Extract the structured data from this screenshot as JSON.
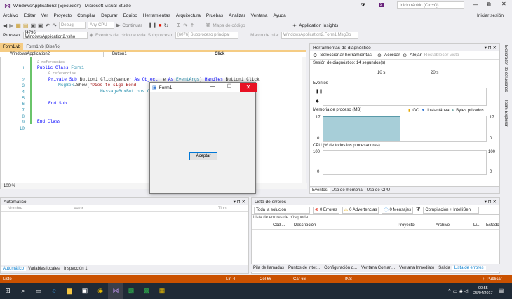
{
  "window": {
    "title": "WindowsApplication2 (Ejecución) - Microsoft Visual Studio",
    "quick_launch": "Inicio rápido (Ctrl+Q)",
    "notif": "2",
    "signin": "Iniciar sesión"
  },
  "menu": [
    "Archivo",
    "Editar",
    "Ver",
    "Proyecto",
    "Compilar",
    "Depurar",
    "Equipo",
    "Herramientas",
    "Arquitectura",
    "Pruebas",
    "Analizar",
    "Ventana",
    "Ayuda"
  ],
  "toolbar": {
    "config": "Debug",
    "platform": "Any CPU",
    "continue": "Continuar",
    "codemap": "Mapa de código",
    "insights": "Application Insights"
  },
  "toolbar2": {
    "process_label": "Proceso:",
    "process": "[4796] WindowsApplication2.vsho",
    "lifecycle": "Eventos del ciclo de vida",
    "thread_label": "Subproceso:",
    "thread": "[6076] Subproceso principal",
    "stack_label": "Marco de pila:",
    "stack": "WindowsApplication2.Form1.MsgBo"
  },
  "editor": {
    "tabs": [
      "Form1.vb",
      "Form1.vb [Diseño]"
    ],
    "nav": [
      "WindowsApplication2",
      "Button1",
      "Click"
    ],
    "zoom": "100 %",
    "line_numbers": [
      "1",
      "2",
      "3",
      "4",
      "5",
      "6",
      "7",
      "8",
      "9",
      "10"
    ],
    "refs1": "2 referencias",
    "refs2": "0 referencias",
    "l1a": "Public ",
    "l1b": "Class ",
    "l1c": "Form1",
    "l2a": "Private Sub ",
    "l2b": "Button1_Click(sender ",
    "l2c": "As ",
    "l2d": "Object",
    "l2e": ", e ",
    "l2f": "As ",
    "l2g": "EventArgs",
    "l2h": ") ",
    "l2i": "Handles ",
    "l2j": "Button1.Click",
    "l3a": "MsgBox",
    "l3b": ".Show(",
    "l3c": "\"Dios te siga Bend",
    "l4": "MessageBoxButtons.O",
    "l6a": "End Sub",
    "l9a": "End Class"
  },
  "form1": {
    "title": "Form1",
    "button": "Aceptar"
  },
  "diag": {
    "title": "Herramientas de diagnóstico",
    "select_tools": "Seleccionar herramientas",
    "zoom_in": "Acercar",
    "zoom_out": "Alejar",
    "reset": "Restablecer vista",
    "session": "Sesión de diagnóstico: 14 segundos(s)",
    "t10": "10 s",
    "t20": "20 s",
    "events": "Eventos",
    "memory": "Memoria de proceso (MB)",
    "gc": "GC",
    "snapshot": "Instantánea",
    "private": "Bytes privados",
    "mem_max": "17",
    "mem_min": "0",
    "cpu": "CPU (% de todos los procesadores)",
    "cpu_max": "100",
    "cpu_min": "0",
    "tabs": [
      "Eventos",
      "Uso de memoria",
      "Uso de CPU"
    ]
  },
  "side_tabs": [
    "Explorador de soluciones",
    "Team Explorer"
  ],
  "auto": {
    "title": "Automático",
    "cols": [
      "Nombre",
      "Valor",
      "Tipo"
    ],
    "tabs": [
      "Automático",
      "Variables locales",
      "Inspección 1"
    ]
  },
  "errors": {
    "title": "Lista de errores",
    "scope": "Toda la solución",
    "errors": "0 Errores",
    "warnings": "0 Advertencias",
    "messages": "0 Mensajes",
    "build": "Compilación + IntelliSen",
    "search": "Lista de errores de búsqueda",
    "cols": [
      "Códi...",
      "Descripción",
      "Proyecto",
      "Archivo",
      "Lí...",
      "Estado"
    ],
    "tabs": [
      "Pila de llamadas",
      "Puntos de inter...",
      "Configuración d...",
      "Ventana Coman...",
      "Ventana Inmediato",
      "Salida",
      "Lista de errores"
    ]
  },
  "status": {
    "left": "Listo",
    "ln": "Lín 4",
    "col": "Col 66",
    "car": "Car 66",
    "ins": "INS",
    "publish": "Publicar"
  },
  "taskbar": {
    "time": "00:55",
    "date": "25/04/2017"
  },
  "colors": {
    "accent": "#007acc",
    "status": "#ca5100",
    "close": "#e81123",
    "memfill": "#a7ced8"
  }
}
